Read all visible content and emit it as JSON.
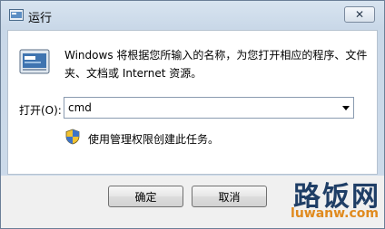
{
  "window": {
    "title": "运行",
    "close_glyph": "✕",
    "title_icon": "run-icon"
  },
  "content": {
    "description": "Windows 将根据您所输入的名称，为您打开相应的程序、文件夹、文档或 Internet 资源。",
    "open_label": "打开(O):",
    "command_value": "cmd",
    "admin_note": "使用管理权限创建此任务。"
  },
  "buttons": {
    "ok": "确定",
    "cancel": "取消"
  },
  "watermark": {
    "text": "路饭网",
    "domain": "luwanw.com"
  },
  "colors": {
    "titlebar": "#c9d8e8",
    "footer": "#f0f0f0",
    "watermark_dark": "#1f3e66",
    "watermark_accent": "#e08a1e"
  }
}
